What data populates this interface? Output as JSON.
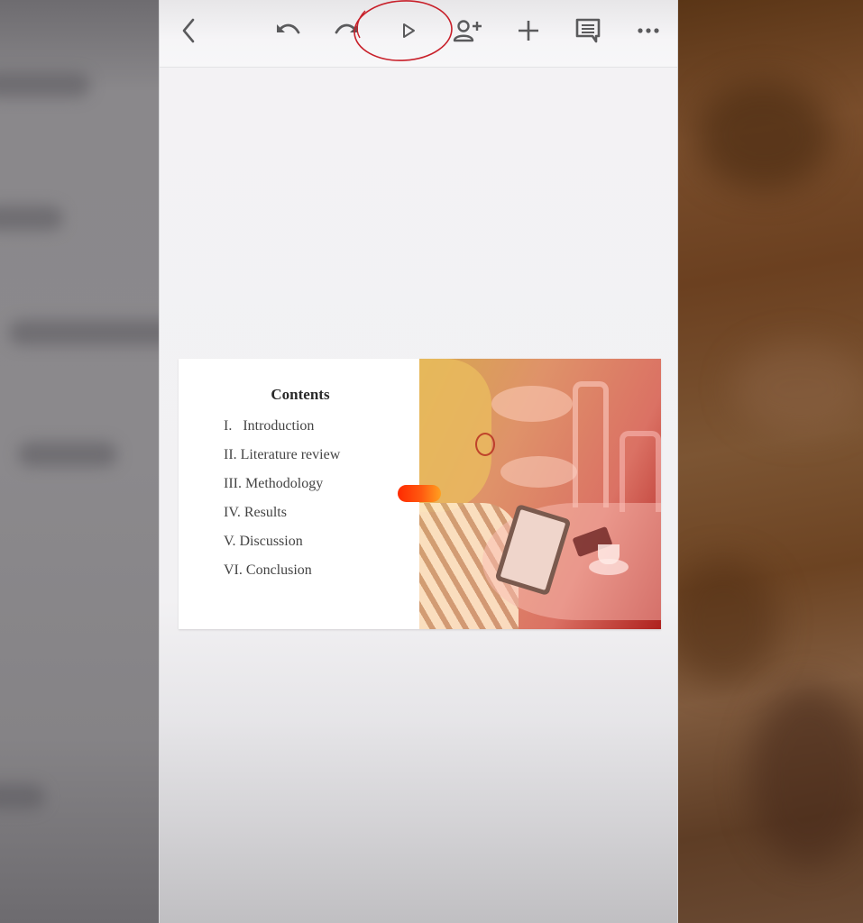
{
  "toolbar": {
    "buttons": [
      {
        "name": "back",
        "icon": "chevron-left-icon",
        "label": "Back"
      },
      {
        "name": "undo",
        "icon": "undo-icon",
        "label": "Undo"
      },
      {
        "name": "redo",
        "icon": "redo-icon",
        "label": "Redo"
      },
      {
        "name": "present",
        "icon": "play-icon",
        "label": "Present"
      },
      {
        "name": "share",
        "icon": "person-add-icon",
        "label": "Share"
      },
      {
        "name": "insert",
        "icon": "plus-icon",
        "label": "Insert"
      },
      {
        "name": "comments",
        "icon": "comment-icon",
        "label": "Comments"
      },
      {
        "name": "more",
        "icon": "more-horizontal-icon",
        "label": "More options"
      }
    ],
    "annotation_color": "#c8202a"
  },
  "slide": {
    "title": "Contents",
    "items": [
      {
        "numeral": "I.",
        "text": "Introduction"
      },
      {
        "numeral": "II.",
        "text": "Literature review"
      },
      {
        "numeral": "III.",
        "text": "Methodology"
      },
      {
        "numeral": "IV.",
        "text": "Results"
      },
      {
        "numeral": "V.",
        "text": "Discussion"
      },
      {
        "numeral": "VI.",
        "text": "Conclusion"
      }
    ],
    "photo_description": "Woman with glasses using a tablet at a cafe table, orange-red gradient overlay",
    "accent_color": "#ff3a00"
  }
}
